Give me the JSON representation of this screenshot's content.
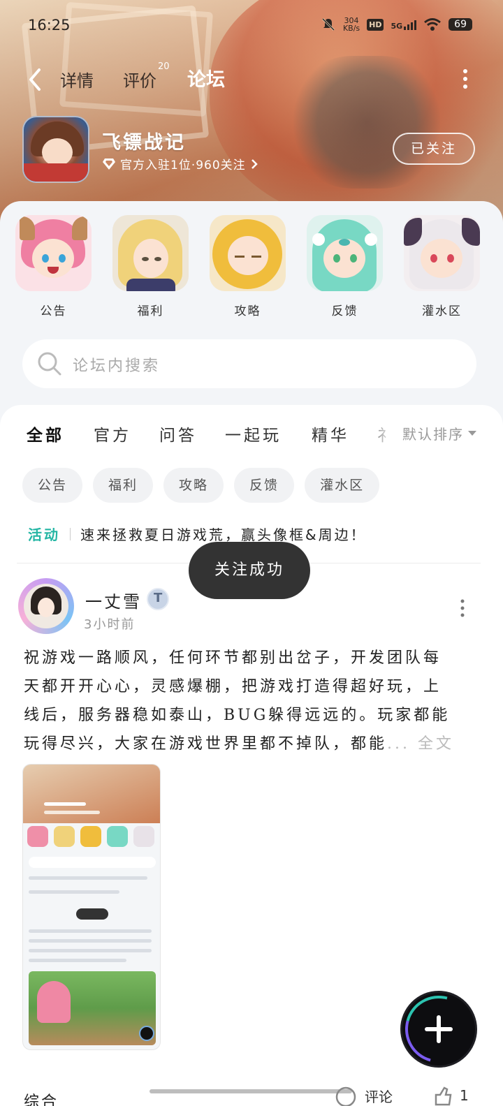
{
  "status_bar": {
    "time": "16:25",
    "net_speed_value": "304",
    "net_speed_unit": "KB/s",
    "hd": "HD",
    "network": "5G",
    "battery": "69"
  },
  "nav": {
    "tabs": [
      {
        "label": "详情"
      },
      {
        "label": "评价",
        "badge": "20"
      },
      {
        "label": "论坛"
      }
    ],
    "active_tab": "论坛"
  },
  "game": {
    "name": "飞镖战记",
    "meta": "官方入驻1位·960关注",
    "follow_label": "已关注"
  },
  "categories": [
    {
      "label": "公告",
      "icon": "pink-catgirl-avatar"
    },
    {
      "label": "福利",
      "icon": "blonde-man-avatar"
    },
    {
      "label": "攻略",
      "icon": "blonde-girl-avatar"
    },
    {
      "label": "反馈",
      "icon": "elf-girl-avatar"
    },
    {
      "label": "灌水区",
      "icon": "demon-girl-avatar"
    }
  ],
  "search": {
    "placeholder": "论坛内搜索"
  },
  "feed_tabs": {
    "items": [
      "全部",
      "官方",
      "问答",
      "一起玩",
      "精华",
      "视频"
    ],
    "visible_partial": "礻",
    "sort_label": "默认排序"
  },
  "chips": [
    "公告",
    "福利",
    "攻略",
    "反馈",
    "灌水区"
  ],
  "activity": {
    "tag": "活动",
    "text": "速来拯救夏日游戏荒，赢头像框&周边！"
  },
  "toast": {
    "text": "关注成功"
  },
  "post": {
    "author": "一丈雪",
    "time": "3小时前",
    "lines": [
      "祝游戏一路顺风，任何环节都别出岔子，开发团队每",
      "天都开开心心，灵感爆棚，把游戏打造得超好玩，上",
      "线后，服务器稳如泰山，BUG躲得远远的。玩家都能",
      "玩得尽兴，大家在游戏世界里都不掉队，都能"
    ],
    "read_more": "... 全文"
  },
  "bottom": {
    "label": "综合",
    "comment_count": "评论",
    "like_count": "1"
  },
  "colors": {
    "accent": "#2cc3b0",
    "toast_bg": "#333333"
  }
}
